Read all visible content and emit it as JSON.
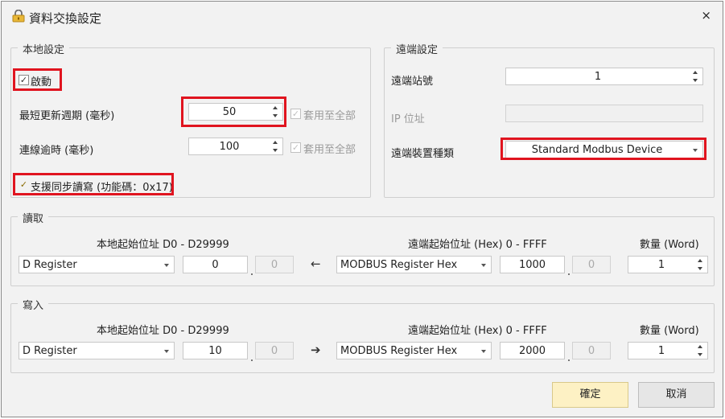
{
  "window": {
    "title": "資料交換設定",
    "close_glyph": "×",
    "icon": "lock-icon"
  },
  "local": {
    "legend": "本地設定",
    "enable_label": "啟動",
    "enable_checked": true,
    "min_period_label": "最短更新週期 (毫秒)",
    "min_period_value": "50",
    "timeout_label": "連線逾時 (毫秒)",
    "timeout_value": "100",
    "apply_all_label": "套用至全部",
    "sync_label": "支援同步讀寫 (功能碼：0x17)",
    "sync_checked": true
  },
  "remote": {
    "legend": "遠端設定",
    "station_label": "遠端站號",
    "station_value": "1",
    "ip_label": "IP 位址",
    "ip_value": "",
    "device_label": "遠端裝置種類",
    "device_value": "Standard Modbus Device"
  },
  "read": {
    "legend": "讀取",
    "local_addr_header": "本地起始位址 D0 - D29999",
    "remote_addr_header": "遠端起始位址 (Hex) 0 - FFFF",
    "qty_header": "數量 (Word)",
    "local_type": "D Register",
    "local_addr": "0",
    "local_offset": "0",
    "direction_glyph": "←",
    "remote_type": "MODBUS Register Hex",
    "remote_addr": "1000",
    "remote_offset": "0",
    "qty": "1"
  },
  "write": {
    "legend": "寫入",
    "local_addr_header": "本地起始位址 D0 - D29999",
    "remote_addr_header": "遠端起始位址 (Hex) 0 - FFFF",
    "qty_header": "數量 (Word)",
    "local_type": "D Register",
    "local_addr": "10",
    "local_offset": "0",
    "direction_glyph": "➔",
    "remote_type": "MODBUS Register Hex",
    "remote_addr": "2000",
    "remote_offset": "0",
    "qty": "1"
  },
  "buttons": {
    "ok": "確定",
    "cancel": "取消"
  },
  "colors": {
    "highlight": "#e0141f",
    "primary_button": "#fdf1c4",
    "window_bg": "#f2f2f2"
  }
}
